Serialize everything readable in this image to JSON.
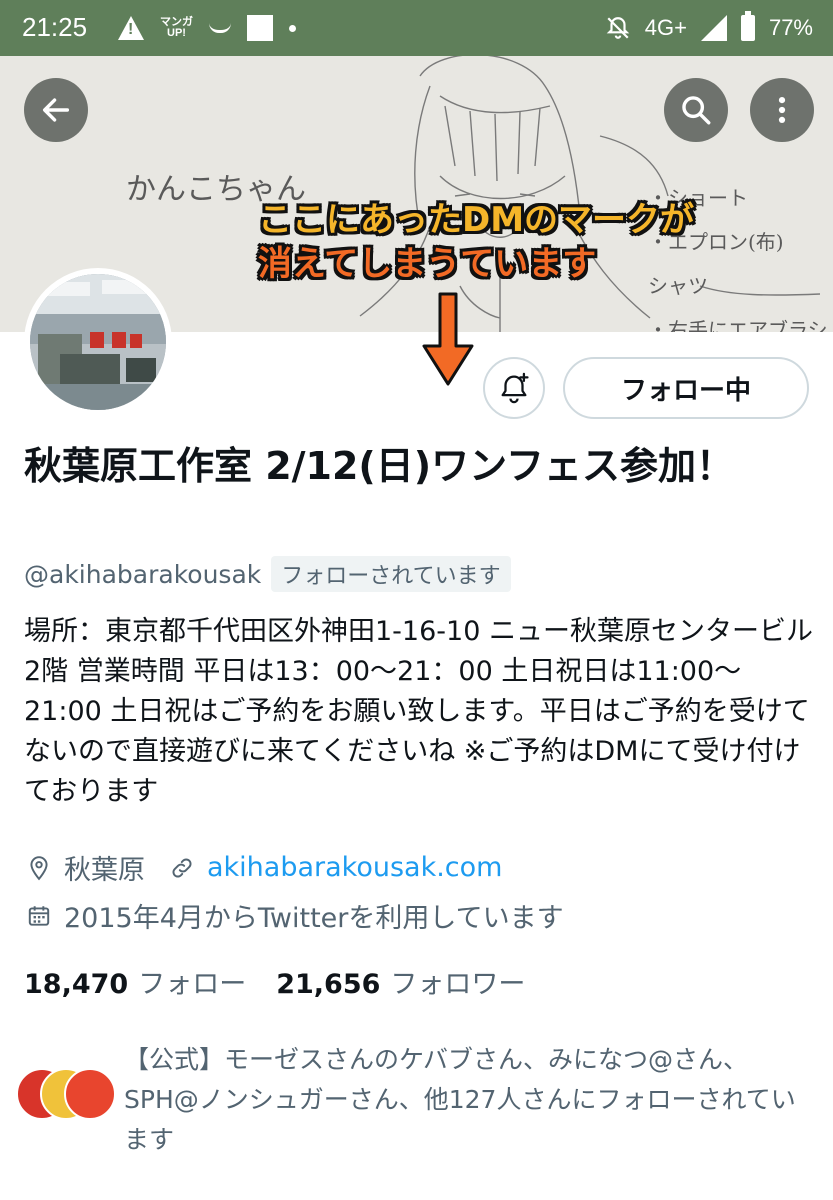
{
  "status_bar": {
    "time": "21:25",
    "app_label": "マンガ\nUP!",
    "network": "4G+",
    "battery": "77%"
  },
  "banner": {
    "sketch_name": "かんこちゃん",
    "sketch_notes": [
      "・ショート",
      "・エプロン(布)",
      "シャツ",
      "・右手にエアブラシ"
    ],
    "annotation_line1": "ここにあったDMのマークが",
    "annotation_line2": "消えてしまうています",
    "annotation_colors": {
      "line1": "#f5b52a",
      "line2": "#f26a25",
      "arrow": "#f26a25"
    }
  },
  "actions": {
    "follow_label": "フォロー中"
  },
  "profile": {
    "name": "秋葉原工作室 2/12(日)ワンフェス参加！",
    "handle": "@akihabarakousak",
    "follows_you": "フォローされています",
    "bio": "場所：東京都千代田区外神田1-16-10 ニュー秋葉原センタービル2階 営業時間 平日は13：00〜21：00 土日祝日は11:00〜21:00 土日祝はご予約をお願い致します。平日はご予約を受けてないので直接遊びに来てくださいね ※ご予約はDMにて受け付けております",
    "location": "秋葉原",
    "url": "akihabarakousak.com",
    "joined": "2015年4月からTwitterを利用しています",
    "following_count": "18,470",
    "following_label": "フォロー",
    "followers_count": "21,656",
    "followers_label": "フォロワー",
    "followed_by": "【公式】モーゼスさんのケバブさん、みになつ@さん、SPH@ノンシュガーさん、他127人さんにフォローされています"
  },
  "icons": [
    "back-arrow-icon",
    "search-icon",
    "more-vertical-icon",
    "bell-plus-icon",
    "location-icon",
    "link-icon",
    "calendar-icon"
  ]
}
